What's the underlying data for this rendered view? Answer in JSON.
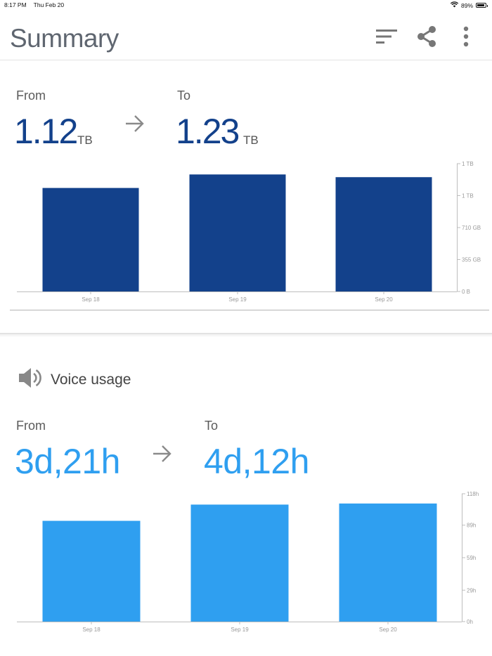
{
  "status": {
    "time": "8:17 PM",
    "date": "Thu Feb 20",
    "battery": "89%",
    "battery_level": 0.89
  },
  "header": {
    "title": "Summary",
    "icons": [
      "sort-icon",
      "share-icon",
      "more-vert-icon"
    ]
  },
  "data_usage": {
    "from_label": "From",
    "to_label": "To",
    "from_value": "1.12",
    "from_unit": "TB",
    "to_value": "1.23",
    "to_unit": "TB",
    "value_color": "#13418b"
  },
  "voice_usage": {
    "title": "Voice usage",
    "icon": "speaker-icon",
    "from_label": "From",
    "to_label": "To",
    "from_value": "3d,21h",
    "to_value": "4d,12h",
    "value_color": "#2f9ff0"
  },
  "chart_data": [
    {
      "type": "bar",
      "categories": [
        "Sep 18",
        "Sep 19",
        "Sep 20"
      ],
      "values": [
        1.15,
        1.3,
        1.27
      ],
      "value_unit": "TB",
      "ylim": [
        0,
        1.42
      ],
      "y_ticks": [
        {
          "value": 0,
          "label": "0 B"
        },
        {
          "value": 0.355,
          "label": "355 GB"
        },
        {
          "value": 0.71,
          "label": "710 GB"
        },
        {
          "value": 1.065,
          "label": "1 TB"
        },
        {
          "value": 1.42,
          "label": "1 TB"
        }
      ],
      "color": "#13418b",
      "grid": false,
      "y_axis_side": "right"
    },
    {
      "type": "bar",
      "categories": [
        "Sep 18",
        "Sep 19",
        "Sep 20"
      ],
      "values": [
        93,
        108,
        109
      ],
      "value_unit": "h",
      "ylim": [
        0,
        118
      ],
      "y_ticks": [
        {
          "value": 0,
          "label": "0h"
        },
        {
          "value": 29,
          "label": "29h"
        },
        {
          "value": 59,
          "label": "59h"
        },
        {
          "value": 89,
          "label": "89h"
        },
        {
          "value": 118,
          "label": "118h"
        }
      ],
      "color": "#2f9ff0",
      "grid": false,
      "y_axis_side": "right"
    }
  ]
}
